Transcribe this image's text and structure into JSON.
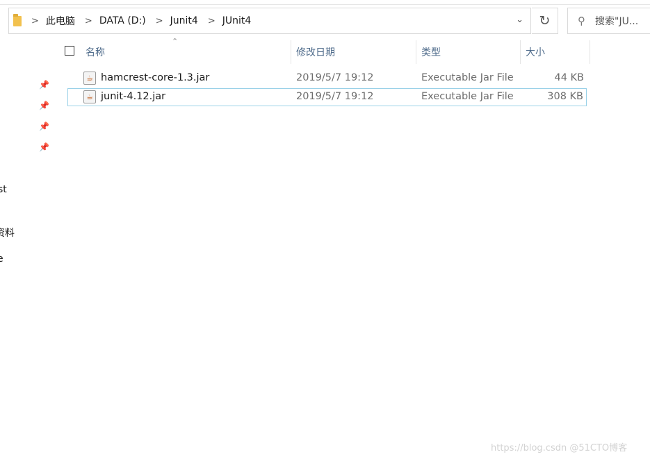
{
  "breadcrumb": {
    "items": [
      "此电脑",
      "DATA (D:)",
      "Junit4",
      "JUnit4"
    ],
    "separator": ">"
  },
  "search": {
    "placeholder": "搜索\"JU..."
  },
  "columns": {
    "name": "名称",
    "date": "修改日期",
    "type": "类型",
    "size": "大小"
  },
  "files": [
    {
      "name": "hamcrest-core-1.3.jar",
      "date": "2019/5/7 19:12",
      "type": "Executable Jar File",
      "size": "44 KB",
      "selected": false
    },
    {
      "name": "junit-4.12.jar",
      "date": "2019/5/7 19:12",
      "type": "Executable Jar File",
      "size": "308 KB",
      "selected": true
    }
  ],
  "nav": {
    "items": [
      "st",
      "资料",
      "e"
    ]
  },
  "watermark": "https://blog.csdn @51CTO博客",
  "icons": {
    "pin": "pin-icon",
    "folder": "folder-icon",
    "refresh": "refresh-icon",
    "search": "search-icon",
    "jar": "jar-file-icon"
  }
}
